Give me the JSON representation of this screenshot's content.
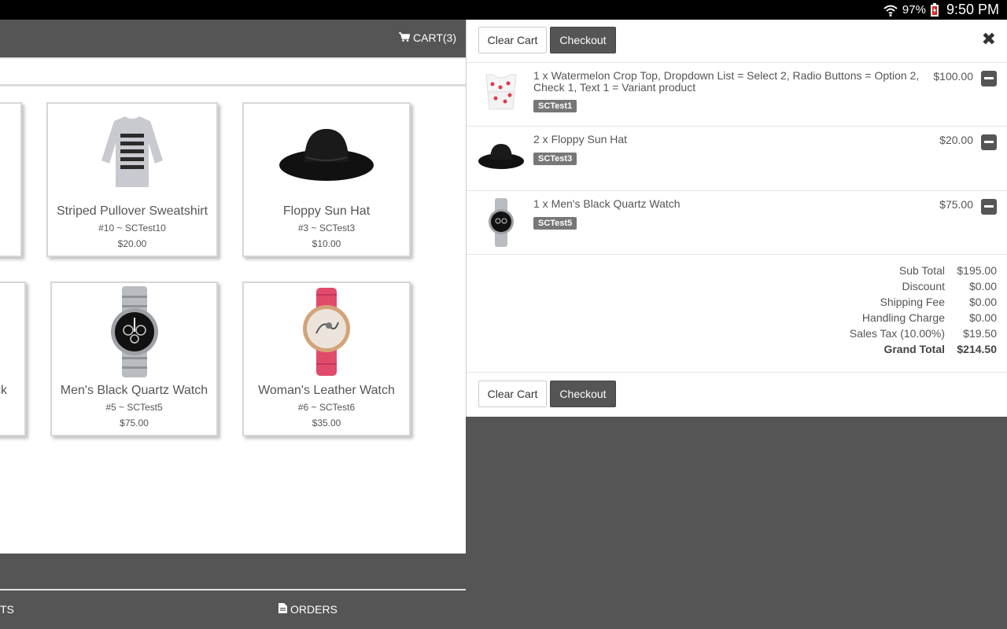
{
  "status_bar": {
    "battery": "97%",
    "time": "9:50 PM"
  },
  "header": {
    "cart_label": "CART(3)"
  },
  "products": [
    {
      "name": "Striped Pullover Sweatshirt",
      "sku": "#10 ~ SCTest10",
      "price": "$20.00"
    },
    {
      "name": "Floppy Sun Hat",
      "sku": "#3 ~ SCTest3",
      "price": "$10.00"
    },
    {
      "name": "Men's Black Quartz Watch",
      "sku": "#5 ~ SCTest5",
      "price": "$75.00"
    },
    {
      "name": "Woman's Leather Watch",
      "sku": "#6 ~ SCTest6",
      "price": "$35.00"
    }
  ],
  "partial_card_text": "ck",
  "bottom_nav": {
    "partial_label": "TS",
    "orders_label": "ORDERS"
  },
  "cart": {
    "clear_label": "Clear Cart",
    "checkout_label": "Checkout",
    "items": [
      {
        "description": "1 x Watermelon Crop Top, Dropdown List = Select 2, Radio Buttons = Option 2, Check 1, Text 1 = Variant product",
        "sku": "SCTest1",
        "amount": "$100.00"
      },
      {
        "description": "2 x Floppy Sun Hat",
        "sku": "SCTest3",
        "amount": "$20.00"
      },
      {
        "description": "1 x Men's Black Quartz Watch",
        "sku": "SCTest5",
        "amount": "$75.00"
      }
    ],
    "totals": {
      "subtotal_label": "Sub Total",
      "subtotal": "$195.00",
      "discount_label": "Discount",
      "discount": "$0.00",
      "shipping_label": "Shipping Fee",
      "shipping": "$0.00",
      "handling_label": "Handling Charge",
      "handling": "$0.00",
      "tax_label": "Sales Tax (10.00%)",
      "tax": "$19.50",
      "grand_label": "Grand Total",
      "grand": "$214.50"
    }
  },
  "colors": {
    "dark_bar": "#555555",
    "badge": "#777777",
    "status_bar": "#000000"
  }
}
